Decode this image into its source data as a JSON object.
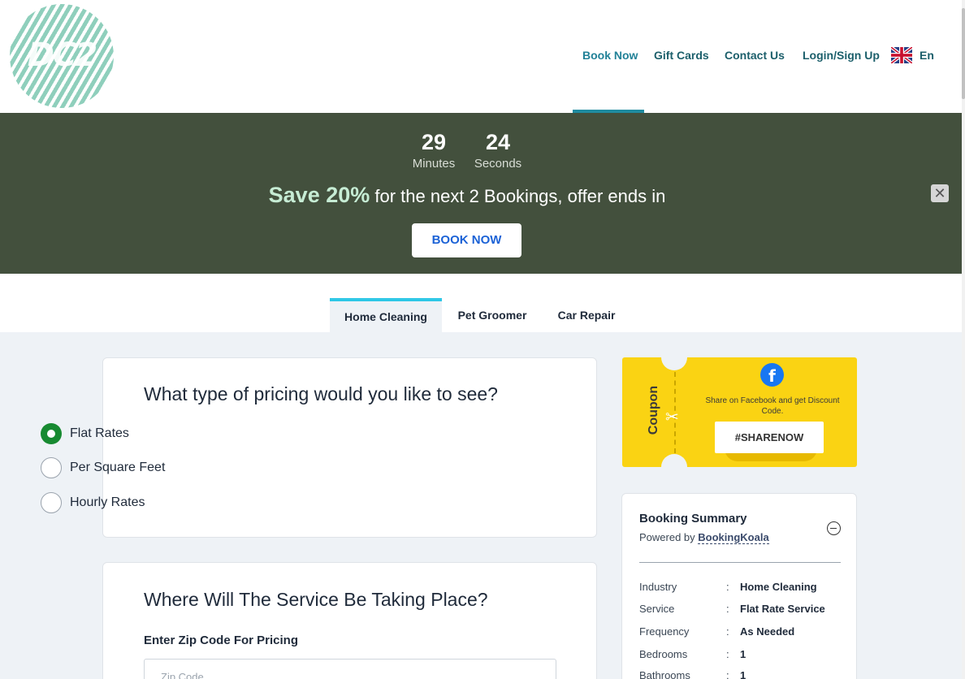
{
  "header": {
    "logo_text": "DC2",
    "nav": {
      "book_now": "Book Now",
      "gift_cards": "Gift Cards",
      "contact_us": "Contact Us",
      "login": "Login/Sign Up",
      "language": "En",
      "language_icon": "uk-flag-icon"
    }
  },
  "promo": {
    "minutes_value": "29",
    "minutes_label": "Minutes",
    "seconds_value": "24",
    "seconds_label": "Seconds",
    "save_text": "Save 20%",
    "offer_text": "for the next 2 Bookings, offer ends in",
    "button_label": "BOOK NOW",
    "close_icon": "close-icon"
  },
  "tabs": [
    {
      "label": "Home Cleaning",
      "active": true
    },
    {
      "label": "Pet Groomer",
      "active": false
    },
    {
      "label": "Car Repair",
      "active": false
    }
  ],
  "pricing": {
    "title": "What type of pricing would you like to see?",
    "options": [
      {
        "label": "Flat Rates",
        "selected": true
      },
      {
        "label": "Per Square Feet",
        "selected": false
      },
      {
        "label": "Hourly Rates",
        "selected": false
      }
    ]
  },
  "location": {
    "title": "Where Will The Service Be Taking Place?",
    "zip_label": "Enter Zip Code For Pricing",
    "zip_placeholder": "Zip Code"
  },
  "coupon": {
    "label": "Coupon",
    "text": "Share on Facebook and get Discount Code.",
    "button_label": "#SHARENOW",
    "facebook_icon": "f",
    "scissors_icon": "✂"
  },
  "summary": {
    "title": "Booking Summary",
    "powered_by": "Powered by",
    "provider": "BookingKoala",
    "rows": [
      {
        "key": "Industry",
        "value": "Home Cleaning"
      },
      {
        "key": "Service",
        "value": "Flat Rate Service"
      },
      {
        "key": "Frequency",
        "value": "As Needed"
      },
      {
        "key": "Bedrooms",
        "value": "1"
      },
      {
        "key": "Bathrooms",
        "value": "1"
      }
    ]
  },
  "colors": {
    "accent": "#1f8ba0",
    "promo_bg": "#43503d",
    "radio_selected": "#178a31",
    "coupon_bg": "#fad313",
    "tab_indicator": "#2ec7e6"
  }
}
